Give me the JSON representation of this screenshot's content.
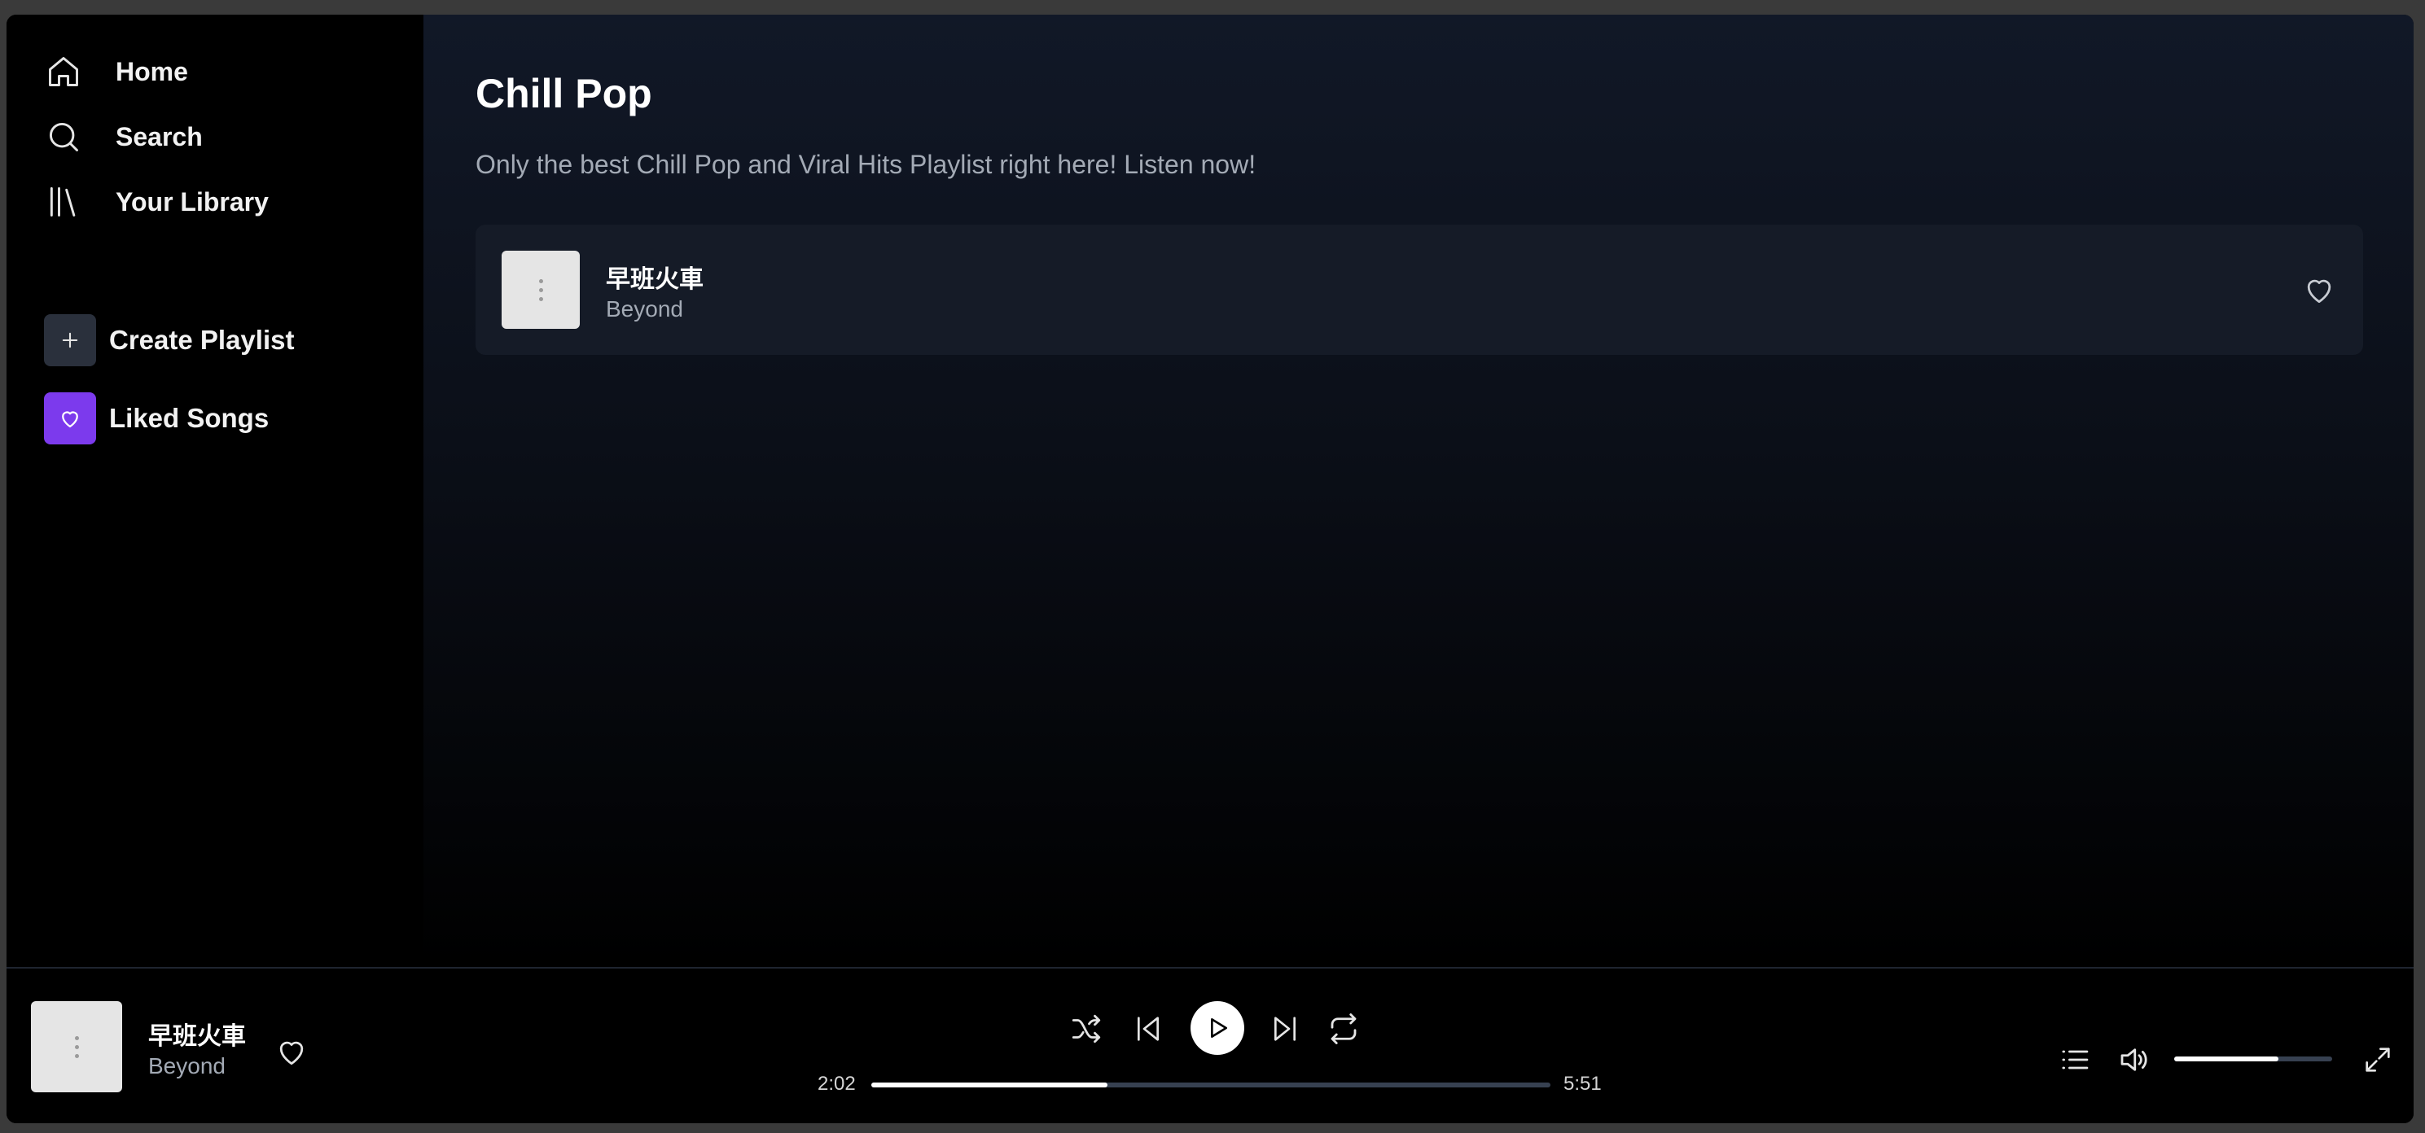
{
  "sidebar": {
    "nav": [
      {
        "label": "Home",
        "icon": "home-icon"
      },
      {
        "label": "Search",
        "icon": "search-icon"
      },
      {
        "label": "Your Library",
        "icon": "library-icon"
      }
    ],
    "create_playlist": {
      "label": "Create Playlist",
      "icon": "plus-icon"
    },
    "liked_songs": {
      "label": "Liked Songs",
      "icon": "heart-icon"
    }
  },
  "playlist": {
    "title": "Chill Pop",
    "description": "Only the best Chill Pop and Viral Hits Playlist right here! Listen now!",
    "tracks": [
      {
        "title": "早班火車",
        "artist": "Beyond"
      }
    ]
  },
  "player": {
    "now_playing": {
      "title": "早班火車",
      "artist": "Beyond"
    },
    "elapsed": "2:02",
    "duration": "5:51",
    "progress_fraction": 0.3476,
    "volume_fraction": 0.66
  },
  "colors": {
    "accent": "#7c3aed",
    "row_bg": "#151b27",
    "muted_text": "#a3aab5"
  }
}
